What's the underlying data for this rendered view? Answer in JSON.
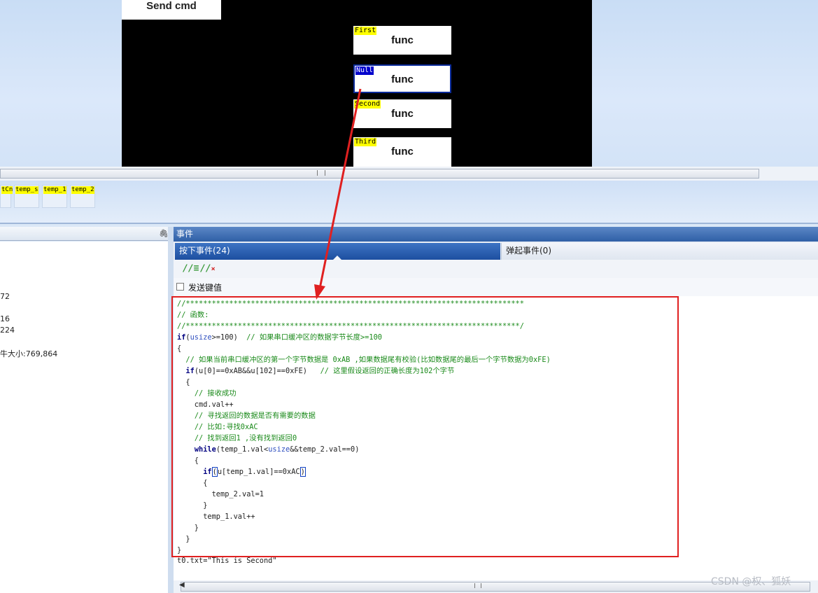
{
  "canvas": {
    "send_cmd_label": "Send cmd",
    "buttons": [
      {
        "tag": "First",
        "label": "func"
      },
      {
        "tag": "Null",
        "label": "func"
      },
      {
        "tag": "Second",
        "label": "func"
      },
      {
        "tag": "Third",
        "label": "func"
      }
    ]
  },
  "components": [
    "tCn",
    "temp_s",
    "temp_1",
    "temp_2"
  ],
  "left_panel": {
    "pin_icon": "pin-icon",
    "lines": [
      "72",
      "16",
      "224",
      "牛大小:769,864"
    ]
  },
  "events": {
    "header": "事件",
    "tab_press": "按下事件(24)",
    "tab_release": "弹起事件(0)",
    "checkbox_label": "发送键值",
    "last_line": "t0.txt=\"This is Second\""
  },
  "colors": {
    "highlight": "#e02020",
    "tab_active": "#2a5cab",
    "tag_yellow": "#ffff00"
  },
  "watermark": "CSDN @权、狐妖"
}
